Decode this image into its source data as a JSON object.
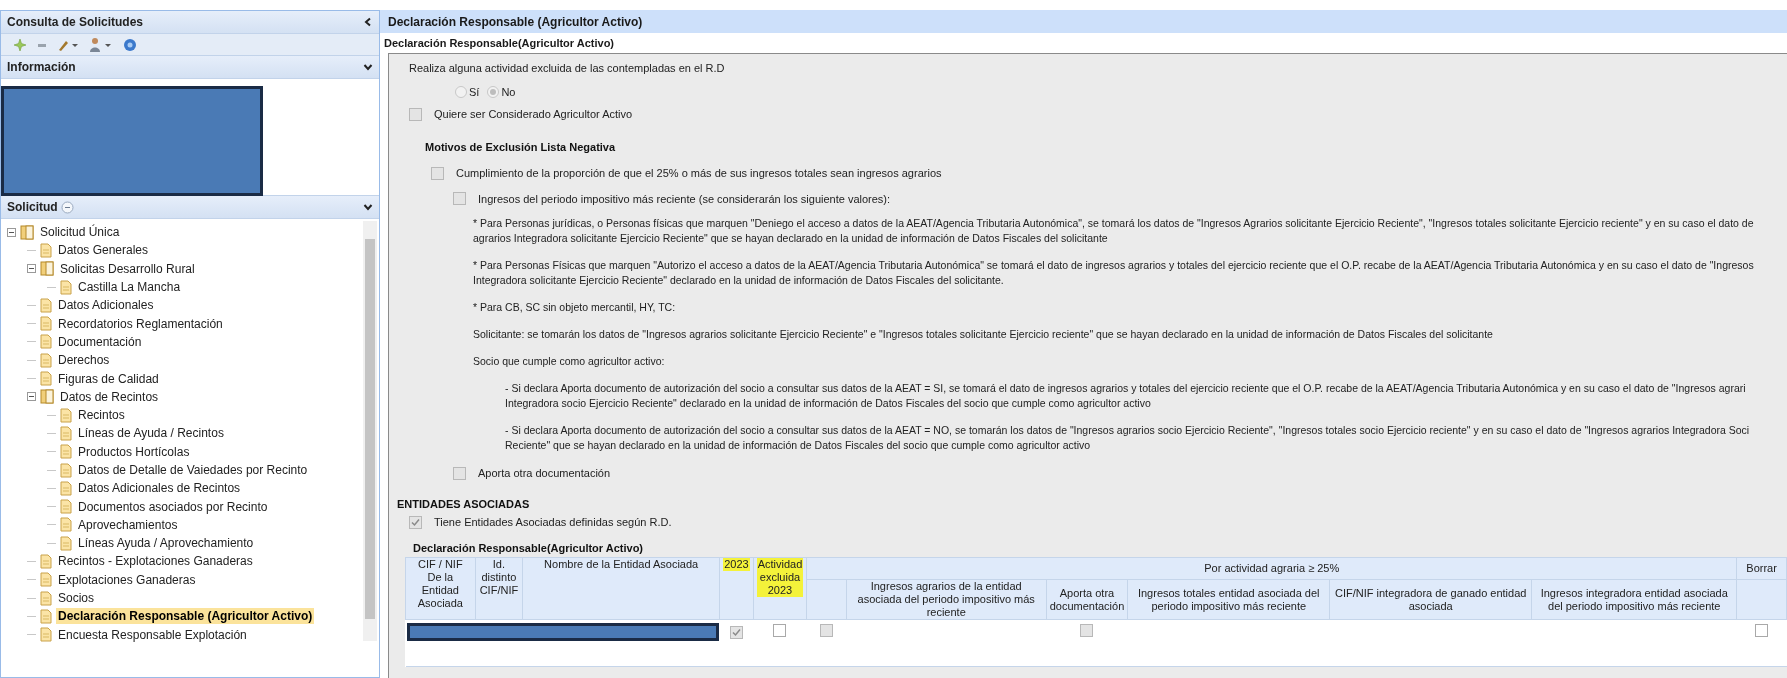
{
  "sidebar": {
    "title": "Consulta de Solicitudes",
    "info": {
      "title": "Información"
    },
    "request": {
      "title": "Solicitud",
      "tree": [
        {
          "label": "Solicitud Única",
          "kind": "folder",
          "expanded": true,
          "selected": false,
          "children": [
            {
              "label": "Datos Generales",
              "kind": "document",
              "selected": false
            },
            {
              "label": "Solicitas Desarrollo Rural",
              "kind": "folder",
              "expanded": true,
              "selected": false,
              "children": [
                {
                  "label": "Castilla La Mancha",
                  "kind": "document",
                  "selected": false
                }
              ]
            },
            {
              "label": "Datos Adicionales",
              "kind": "document",
              "selected": false
            },
            {
              "label": "Recordatorios Reglamentación",
              "kind": "document",
              "selected": false
            },
            {
              "label": "Documentación",
              "kind": "document",
              "selected": false
            },
            {
              "label": "Derechos",
              "kind": "document",
              "selected": false
            },
            {
              "label": "Figuras de Calidad",
              "kind": "document",
              "selected": false
            },
            {
              "label": "Datos de Recintos",
              "kind": "folder",
              "expanded": true,
              "selected": false,
              "children": [
                {
                  "label": "Recintos",
                  "kind": "document",
                  "selected": false
                },
                {
                  "label": "Líneas de Ayuda / Recintos",
                  "kind": "document",
                  "selected": false
                },
                {
                  "label": "Productos Hortícolas",
                  "kind": "document",
                  "selected": false
                },
                {
                  "label": "Datos de Detalle de Vaiedades por Recinto",
                  "kind": "document",
                  "selected": false
                },
                {
                  "label": "Datos Adicionales de Recintos",
                  "kind": "document",
                  "selected": false
                },
                {
                  "label": "Documentos asociados por Recinto",
                  "kind": "document",
                  "selected": false
                },
                {
                  "label": "Aprovechamientos",
                  "kind": "document",
                  "selected": false
                },
                {
                  "label": "Líneas Ayuda / Aprovechamiento",
                  "kind": "document",
                  "selected": false
                }
              ]
            },
            {
              "label": "Recintos - Explotaciones Ganaderas",
              "kind": "document",
              "selected": false
            },
            {
              "label": "Explotaciones Ganaderas",
              "kind": "document",
              "selected": false
            },
            {
              "label": "Socios",
              "kind": "document",
              "selected": false
            },
            {
              "label": "Declaración Responsable (Agricultor Activo)",
              "kind": "document",
              "selected": true
            },
            {
              "label": "Encuesta Responsable Explotación",
              "kind": "document",
              "selected": false
            }
          ]
        }
      ]
    }
  },
  "main": {
    "title": "Declaración Responsable (Agricultor Activo)",
    "form_title": "Declaración Responsable(Agricultor Activo)",
    "question": "Realiza alguna actividad excluida de las contempladas en el R.D",
    "radios": [
      {
        "label": "Sí",
        "selected": false
      },
      {
        "label": "No",
        "selected": true
      }
    ],
    "considered": {
      "label": "Quiere ser Considerado Agricultor Activo",
      "checked": false
    },
    "exclusion": {
      "heading": "Motivos de Exclusión Lista Negativa",
      "criterion": {
        "label": "Cumplimiento de la proporción de que el 25% o más de sus ingresos totales sean ingresos agrarios",
        "checked": false
      },
      "income": {
        "label": "Ingresos del periodo impositivo más reciente (se considerarán los siguiente valores):",
        "checked": false
      },
      "notes": [
        {
          "lines": [
            "* Para Personas jurídicas, o Personas físicas que marquen \"Deniego el acceso a datos de la AEAT/Agencia Tributaria Autonómica\", se tomará los datos de \"Ingresos Agrarios solicitante Ejercicio Reciente\", \"Ingresos totales solicitante Ejercicio reciente\" y en su caso el dato de",
            "agrarios Integradora solicitante Ejercicio Reciente\" que se hayan declarado en la unidad de información de Datos Fiscales del solicitante"
          ]
        },
        {
          "lines": [
            "* Para Personas Físicas que marquen \"Autorizo el acceso a datos de la AEAT/Agencia Tributaria Autonómica\" se tomará el dato de ingresos agrarios y totales del ejercicio reciente que el O.P. recabe de la AEAT/Agencia Tributaria Autonómica y en su caso el dato de \"Ingresos",
            "Integradora solicitante Ejercicio Reciente\" declarado en la unidad de información de Datos Fiscales del solicitante."
          ]
        },
        {
          "lines": [
            "* Para CB, SC sin objeto mercantil, HY, TC:"
          ]
        },
        {
          "lines": [
            "Solicitante: se tomarán los datos de \"Ingresos agrarios solicitante Ejercicio Reciente\" e \"Ingresos totales solicitante Ejercicio reciente\" que se hayan declarado en la unidad de información de Datos Fiscales del solicitante"
          ]
        },
        {
          "lines": [
            "Socio que cumple como agricultor activo:"
          ],
          "children": [
            {
              "lines": [
                "- Si declara Aporta documento de autorización del socio a consultar sus datos de la AEAT = SI, se tomará el dato de ingresos agrarios y totales del ejercicio reciente que el O.P. recabe de la AEAT/Agencia Tributaria Autonómica y en su caso el dato de \"Ingresos agrari",
                "Integradora socio Ejercicio Reciente\" declarado en la unidad de información de Datos Fiscales del socio que cumple como agricultor activo"
              ]
            },
            {
              "lines": [
                "- Si declara Aporta documento de autorización del socio a consultar sus datos de la AEAT = NO, se tomarán los datos de \"Ingresos agrarios socio Ejercicio Reciente\", \"Ingresos totales socio Ejercicio reciente\" y en su caso el dato de \"Ingresos agrarios Integradora Soci",
                "Reciente\" que se hayan declarado en la unidad de información de Datos Fiscales del socio que cumple como agricultor activo"
              ]
            }
          ]
        }
      ],
      "other_docs": {
        "label": "Aporta otra documentación",
        "checked": false
      }
    },
    "entities": {
      "heading": "ENTIDADES ASOCIADAS",
      "defined": {
        "label": "Tiene Entidades Asociadas definidas según R.D.",
        "checked": true
      },
      "table": {
        "title": "Declaración Responsable(Agricultor Activo)",
        "columns": [
          {
            "label": "CIF / NIF De la Entidad Asociada",
            "highlighted": false
          },
          {
            "label": "Id. distinto CIF/NIF",
            "highlighted": false
          },
          {
            "label": "Nombre de la Entidad Asociada",
            "highlighted": false
          },
          {
            "label": "2023",
            "highlighted": true
          },
          {
            "label": "Actividad excluida 2023",
            "highlighted": true
          }
        ],
        "group": {
          "label": "Por actividad agraria ≥ 25%",
          "columns": [
            {
              "label": "Ingresos agrarios de la entidad asociada del periodo impositivo más reciente"
            },
            {
              "label": "Aporta otra documentación"
            },
            {
              "label": "Ingresos totales entidad asociada del periodo impositivo más reciente"
            },
            {
              "label": "CIF/NIF integradora de ganado entidad asociada"
            },
            {
              "label": "Ingresos integradora entidad asociada del periodo impositivo más reciente"
            }
          ]
        },
        "delete_column": {
          "label": "Borrar"
        },
        "rows": [
          {
            "cells": [
              {
                "kind": "redacted"
              },
              {
                "kind": "checkbox",
                "checked": true,
                "disabled": true
              },
              {
                "kind": "checkbox",
                "checked": false,
                "disabled": false
              },
              {
                "kind": "checkbox",
                "checked": false,
                "disabled": true
              },
              {
                "kind": "empty"
              },
              {
                "kind": "checkbox",
                "checked": false,
                "disabled": true
              },
              {
                "kind": "empty"
              },
              {
                "kind": "empty"
              },
              {
                "kind": "empty"
              },
              {
                "kind": "checkbox",
                "checked": false,
                "disabled": false
              }
            ]
          }
        ]
      }
    }
  }
}
